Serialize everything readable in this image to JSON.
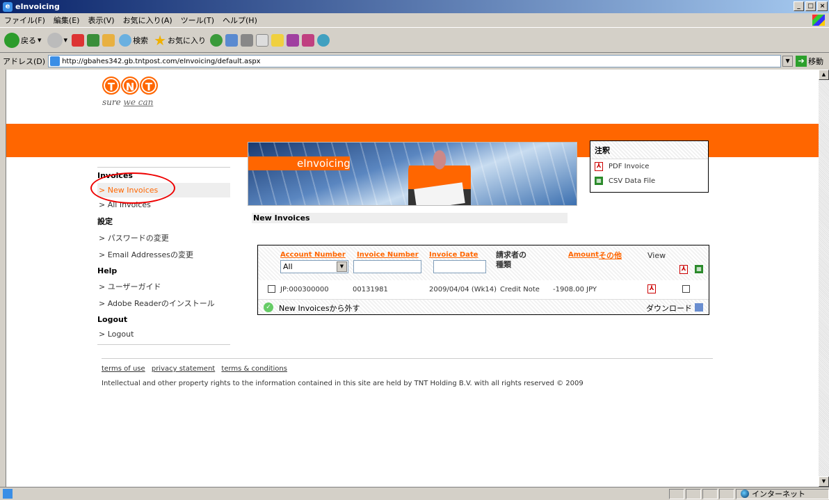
{
  "window": {
    "title": "eInvoicing",
    "buttons": [
      "_",
      "□",
      "×"
    ]
  },
  "menu": [
    "ファイル(F)",
    "編集(E)",
    "表示(V)",
    "お気に入り(A)",
    "ツール(T)",
    "ヘルプ(H)"
  ],
  "toolbar": {
    "back": "戻る",
    "search": "検索",
    "favorites": "お気に入り"
  },
  "address": {
    "label": "アドレス(D)",
    "url": "http://gbahes342.gb.tntpost.com/eInvoicing/default.aspx",
    "go": "移動"
  },
  "logo": {
    "letters": [
      "T",
      "N",
      "T"
    ],
    "slogan_a": "sure ",
    "slogan_b": "we can"
  },
  "banner": {
    "label": "eInvoicing"
  },
  "notes": {
    "title": "注釈",
    "pdf": "PDF Invoice",
    "csv": "CSV Data File"
  },
  "sidebar": {
    "invoice_head": "Invoices",
    "new_invoices": "> New Invoices",
    "all_invoices": "> All Invoices",
    "settings_head": "設定",
    "password": "> パスワードの変更",
    "email": "> Email Addressesの変更",
    "help_head": "Help",
    "guide": "> ユーザーガイド",
    "adobe": "> Adobe Readerのインストール",
    "logout_head": "Logout",
    "logout": "> Logout"
  },
  "section_title": "New Invoices",
  "table": {
    "col_account": "Account Number",
    "col_invoice": "Invoice Number",
    "col_date": "Invoice Date",
    "col_claimant_1": "請求者の",
    "col_claimant_2": "種類",
    "col_amount": "Amount",
    "col_other": "その他",
    "col_view": "View",
    "filter_account": "All",
    "row": {
      "account": "JP:000300000",
      "invoice": "00131981",
      "date": "2009/04/04 (Wk14)",
      "type": "Credit Note",
      "amount": "-1908.00 JPY"
    },
    "remove_label": "New Invoicesから外す",
    "download_label": "ダウンロード"
  },
  "footer": {
    "terms": "terms of use",
    "privacy": "privacy statement",
    "conditions": "terms & conditions",
    "copyright": "Intellectual and other property rights to the information contained in this site are held by TNT Holding B.V. with all rights reserved © 2009"
  },
  "status": {
    "zone": "インターネット"
  }
}
